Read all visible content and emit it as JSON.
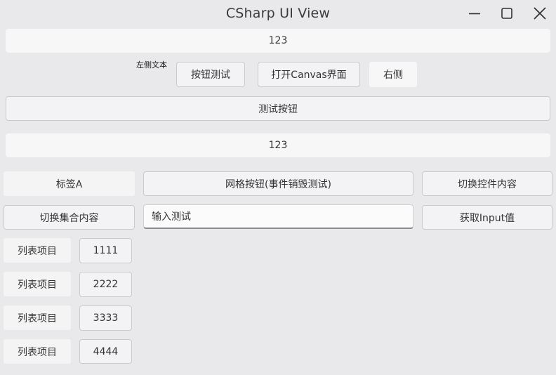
{
  "window": {
    "title": "CSharp UI View",
    "controls": {
      "minimize": "minimize-icon",
      "maximize": "maximize-icon",
      "close": "close-icon"
    }
  },
  "top_text_1": "123",
  "row1": {
    "left_text": "左侧文本",
    "button_test": "按钮测试",
    "open_canvas": "打开Canvas界面",
    "right_label": "右侧"
  },
  "test_button": "测试按钮",
  "top_text_2": "123",
  "grid": {
    "label_a": "标签A",
    "grid_button": "网格按钮(事件销毁测试)",
    "toggle_control": "切换控件内容",
    "toggle_collection": "切换集合内容",
    "input_value": "输入测试",
    "get_input": "获取Input值"
  },
  "list": [
    {
      "label": "列表项目",
      "value": "1111"
    },
    {
      "label": "列表项目",
      "value": "2222"
    },
    {
      "label": "列表项目",
      "value": "3333"
    },
    {
      "label": "列表项目",
      "value": "4444"
    }
  ],
  "colors": {
    "background": "#e9e9ec",
    "surface": "#f7f7f8",
    "border": "#c9c9cf"
  }
}
